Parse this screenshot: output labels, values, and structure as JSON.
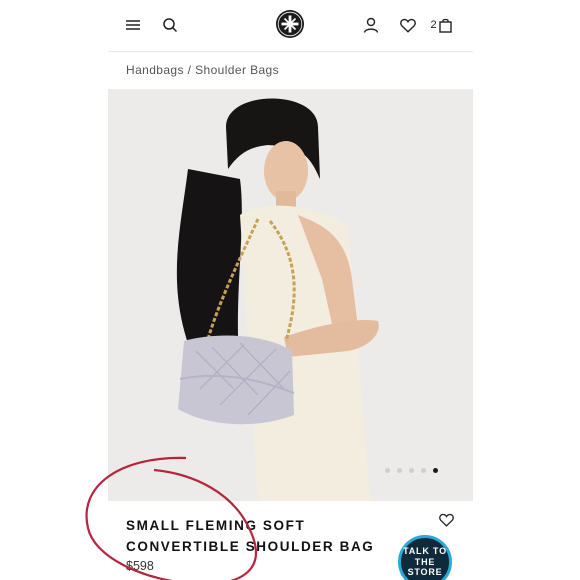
{
  "header": {
    "cart_count": "2"
  },
  "breadcrumb": "Handbags / Shoulder Bags",
  "gallery": {
    "slide_count": 5,
    "active_slide": 5
  },
  "product": {
    "title": "SMALL FLEMING SOFT CONVERTIBLE SHOULDER BAG",
    "price": "$598"
  },
  "chat_badge": {
    "label": "TALK TO THE STORE"
  },
  "colors": {
    "brand_dark": "#0e2a3b",
    "badge_ring": "#2aa8d8",
    "annotation_red": "#b5253d",
    "hero_bg": "#ecebe9"
  }
}
